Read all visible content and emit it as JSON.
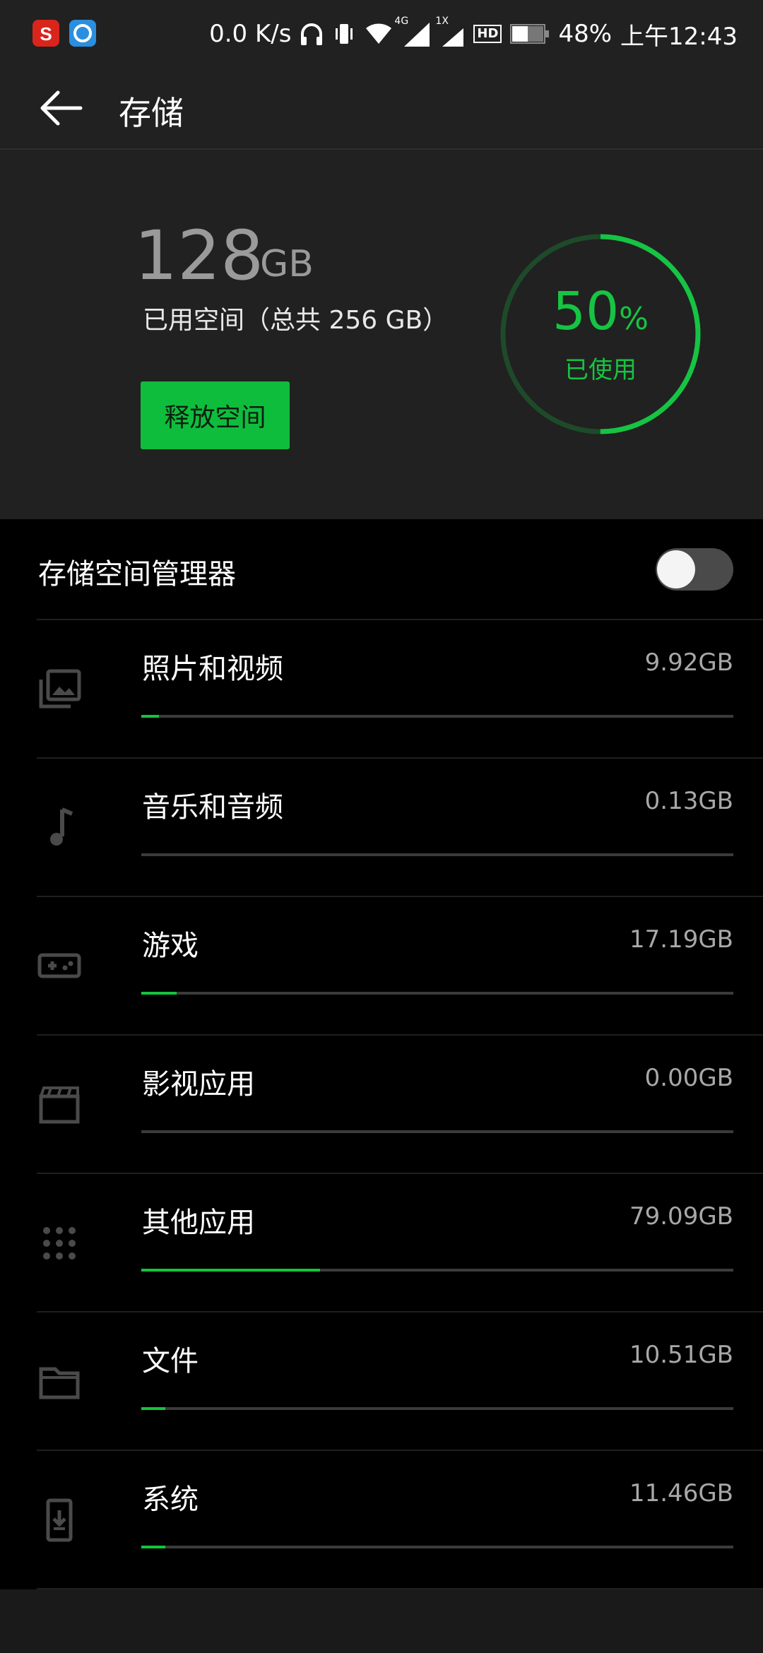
{
  "status_bar": {
    "net_speed": "0.0 K/s",
    "network_label": "4G",
    "sim2_label": "1X",
    "hd_label": "HD",
    "battery": "48%",
    "time": "上午12:43",
    "icons": [
      "sogou-app-icon",
      "browser-app-icon",
      "headphones-icon",
      "vibrate-icon",
      "wifi-icon",
      "signal-icon",
      "signal-2-icon",
      "battery-icon"
    ]
  },
  "app_bar": {
    "title": "存储",
    "back_icon": "arrow-left-icon"
  },
  "summary": {
    "used_value": "128",
    "used_unit": "GB",
    "used_desc": "已用空间（总共 256 GB）",
    "free_button": "释放空间",
    "percent_value": "50",
    "percent_sign": "%",
    "percent_label": "已使用",
    "percent_fraction": 0.5,
    "ring_color": "#16c443",
    "ring_track_color": "#1e4a2a"
  },
  "manager": {
    "label": "存储空间管理器",
    "enabled": false
  },
  "categories": [
    {
      "name": "照片和视频",
      "size": "9.92GB",
      "fraction": 0.03,
      "icon": "photo-library-icon"
    },
    {
      "name": "音乐和音频",
      "size": "0.13GB",
      "fraction": 0.0,
      "icon": "music-note-icon"
    },
    {
      "name": "游戏",
      "size": "17.19GB",
      "fraction": 0.06,
      "icon": "gamepad-icon"
    },
    {
      "name": "影视应用",
      "size": "0.00GB",
      "fraction": 0.0,
      "icon": "movie-icon"
    },
    {
      "name": "其他应用",
      "size": "79.09GB",
      "fraction": 0.302,
      "icon": "apps-grid-icon"
    },
    {
      "name": "文件",
      "size": "10.51GB",
      "fraction": 0.04,
      "icon": "folder-icon"
    },
    {
      "name": "系统",
      "size": "11.46GB",
      "fraction": 0.04,
      "icon": "system-update-icon"
    }
  ],
  "colors": {
    "accent": "#14c43d",
    "background": "#000000",
    "header": "#212121"
  }
}
